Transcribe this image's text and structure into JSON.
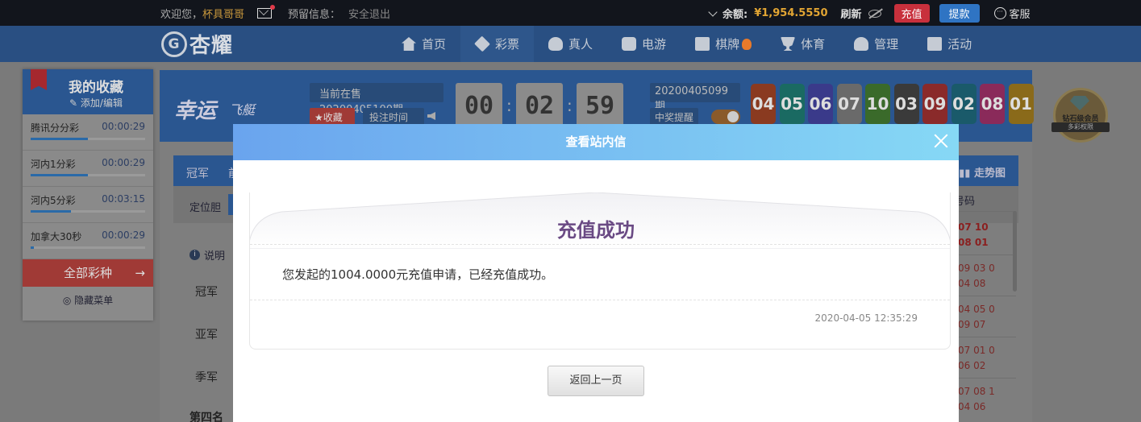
{
  "topbar": {
    "welcome": "欢迎您，",
    "username": "杯具哥哥",
    "reserve_label": "预留信息：",
    "logout": "安全退出",
    "balance_label": "余额:",
    "balance_value": "¥1,954.5550",
    "refresh": "刷新",
    "recharge": "充值",
    "withdraw": "提款",
    "service": "客服"
  },
  "nav": {
    "logo_text": "杏耀",
    "items": [
      {
        "label": "首页",
        "icon": "home-icon"
      },
      {
        "label": "彩票",
        "icon": "ticket-icon"
      },
      {
        "label": "真人",
        "icon": "live-dealer-icon"
      },
      {
        "label": "电游",
        "icon": "game-machine-icon"
      },
      {
        "label": "棋牌",
        "icon": "card-game-icon"
      },
      {
        "label": "体育",
        "icon": "trophy-icon"
      },
      {
        "label": "管理",
        "icon": "users-icon"
      },
      {
        "label": "活动",
        "icon": "gift-icon"
      }
    ]
  },
  "favorites": {
    "title": "我的收藏",
    "edit": "添加/编辑",
    "items": [
      {
        "name": "腾讯分分彩",
        "time": "00:00:29",
        "progress": 0.5
      },
      {
        "name": "河内1分彩",
        "time": "00:00:29",
        "progress": 0.5
      },
      {
        "name": "河内5分彩",
        "time": "00:03:15",
        "progress": 0.35
      },
      {
        "name": "加拿大30秒",
        "time": "00:00:29",
        "progress": 0.03
      }
    ],
    "all_games": "全部彩种",
    "hide_menu": "隐藏菜单"
  },
  "game": {
    "title": "幸运",
    "subtitle": "飞艇",
    "current_issue": "当前在售20200405100期",
    "fav_btn": "★收藏",
    "bet_time": "投注时间",
    "countdown": [
      "00",
      "02",
      "59"
    ],
    "last_issue": "20200405099期",
    "win_remind": "中奖提醒",
    "balls": [
      {
        "n": "04",
        "c": "#8a3a20"
      },
      {
        "n": "05",
        "c": "#1a6a62"
      },
      {
        "n": "06",
        "c": "#3a3a8a"
      },
      {
        "n": "07",
        "c": "#6a6a6a"
      },
      {
        "n": "10",
        "c": "#3a6a2a"
      },
      {
        "n": "03",
        "c": "#3a3a3a"
      },
      {
        "n": "09",
        "c": "#8a2a2a"
      },
      {
        "n": "02",
        "c": "#1a5a6a"
      },
      {
        "n": "08",
        "c": "#8a2a5a"
      },
      {
        "n": "01",
        "c": "#8a6a1a"
      }
    ]
  },
  "board": {
    "tab1": "冠军",
    "tab2": "前",
    "trend": "走势图",
    "filter_label": "定位胆",
    "explain": "说明",
    "ranks": [
      "冠军",
      "亚军",
      "季军",
      "第四名"
    ],
    "history_head": "号码",
    "history": [
      [
        "07 10",
        "08 01"
      ],
      [
        "09 03 0",
        "04 08"
      ],
      [
        "04 05 0",
        "09 07"
      ],
      [
        "07 01 0",
        "06 02"
      ],
      [
        "07 08 1",
        "04 06"
      ]
    ]
  },
  "badge": {
    "line1": "钻石级会员",
    "line2": "多彩权限"
  },
  "modal": {
    "header": "查看站内信",
    "title": "充值成功",
    "body": "您发起的1004.0000元充值申请，已经充值成功。",
    "time": "2020-04-05 12:35:29",
    "back": "返回上一页"
  }
}
